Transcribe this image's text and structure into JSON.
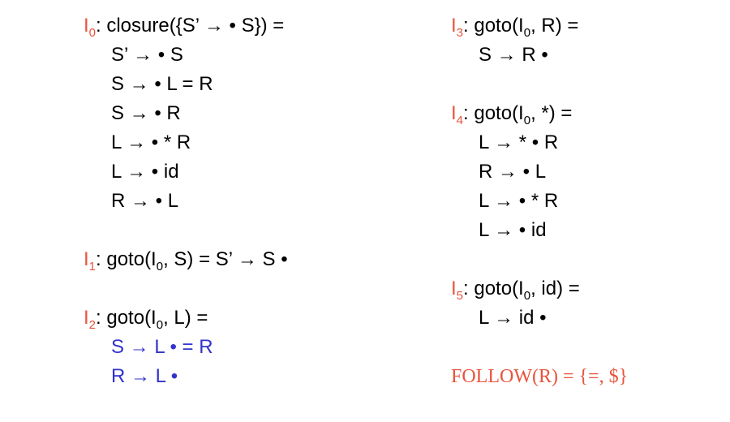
{
  "left": {
    "i0": {
      "label_prefix": "I",
      "label_sub": "0",
      "header": ": closure({S’ → • S}) =",
      "items": [
        "S’ → • S",
        "S → • L = R",
        "S → • R",
        "L → • * R",
        "L → • id",
        "R → • L"
      ]
    },
    "i1": {
      "label_prefix": "I",
      "label_sub": "1",
      "header_a": ": goto(I",
      "header_sub": "0",
      "header_b": ", S) = S’ → S •"
    },
    "i2": {
      "label_prefix": "I",
      "label_sub": "2",
      "header_a": ": goto(I",
      "header_sub": "0",
      "header_b": ", L) =",
      "items": [
        "S → L • = R",
        "R → L •"
      ]
    }
  },
  "right": {
    "i3": {
      "label_prefix": "I",
      "label_sub": "3",
      "header_a": ": goto(I",
      "header_sub": "0",
      "header_b": ", R) =",
      "items": [
        "S → R •"
      ]
    },
    "i4": {
      "label_prefix": "I",
      "label_sub": "4",
      "header_a": ": goto(I",
      "header_sub": "0",
      "header_b": ", *) =",
      "items": [
        "L → * • R",
        "R → • L",
        "L → • * R",
        "L → • id"
      ]
    },
    "i5": {
      "label_prefix": "I",
      "label_sub": "5",
      "header_a": ": goto(I",
      "header_sub": "0",
      "header_b": ", id) =",
      "items": [
        "L → id •"
      ]
    },
    "follow": "FOLLOW(R) = {=, $}"
  },
  "colors": {
    "label": "#e8543c",
    "highlight": "#3333cc",
    "text": "#000000"
  }
}
